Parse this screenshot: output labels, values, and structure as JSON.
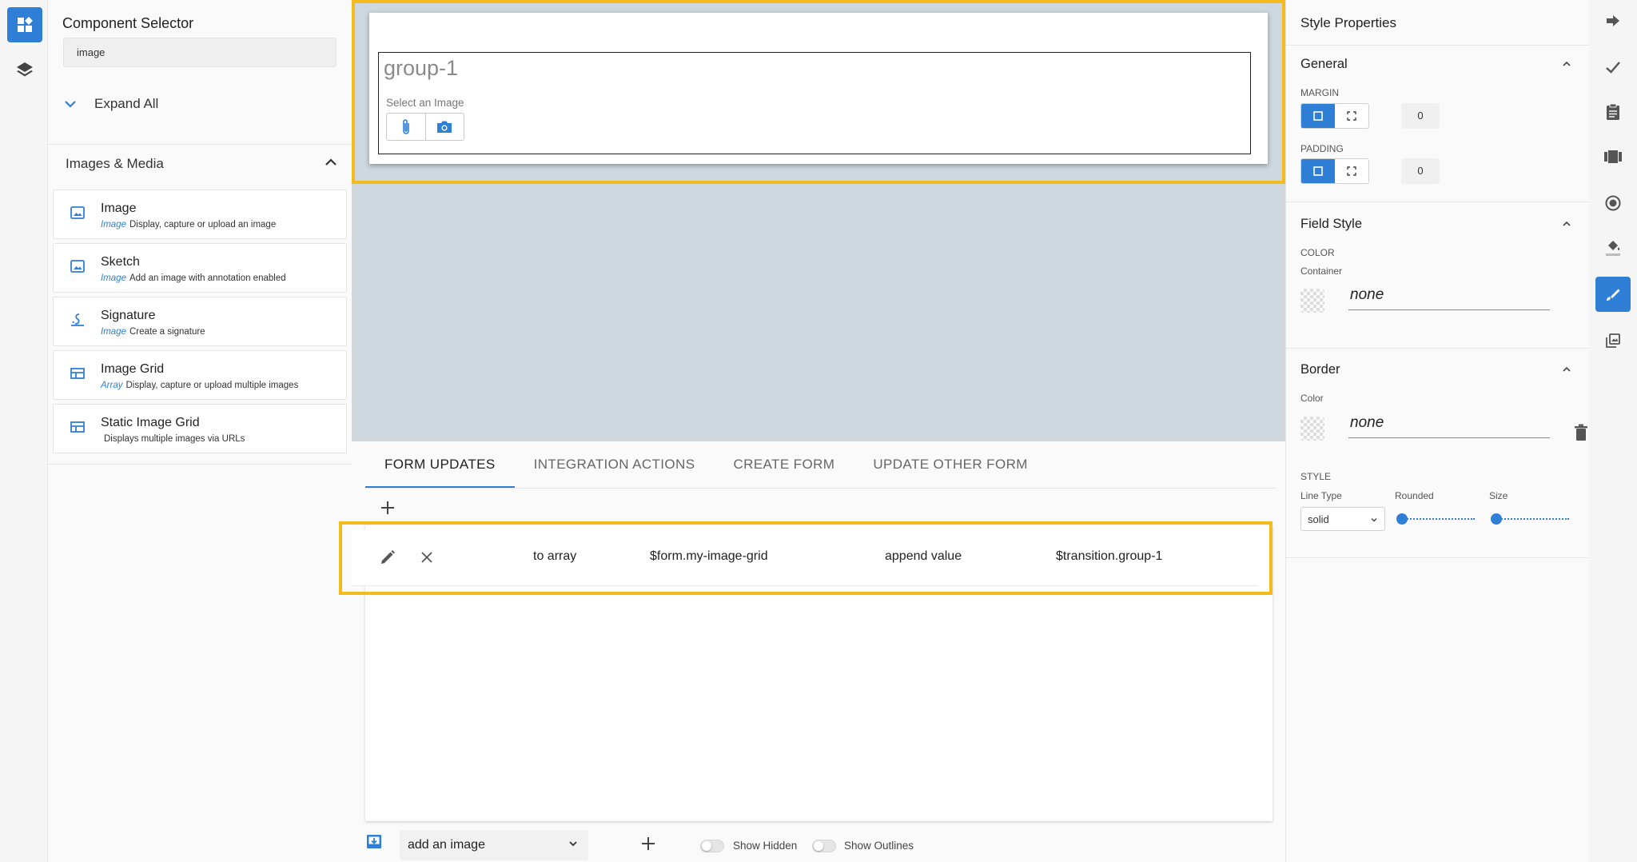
{
  "left_panel": {
    "title": "Component Selector",
    "search_value": "image",
    "expand_all_label": "Expand All",
    "section_title": "Images & Media",
    "components": [
      {
        "name": "Image",
        "type": "Image",
        "description": "Display, capture or upload an image",
        "icon": "image-icon"
      },
      {
        "name": "Sketch",
        "type": "Image",
        "description": "Add an image with annotation enabled",
        "icon": "image-icon"
      },
      {
        "name": "Signature",
        "type": "Image",
        "description": "Create a signature",
        "icon": "signature-icon"
      },
      {
        "name": "Image Grid",
        "type": "Array",
        "description": "Display, capture or upload multiple images",
        "icon": "grid-icon"
      },
      {
        "name": "Static Image Grid",
        "type": "",
        "description": "Displays multiple images via URLs",
        "icon": "grid-icon"
      }
    ]
  },
  "canvas": {
    "group_title": "group-1",
    "select_image_label": "Select an Image"
  },
  "tabs": [
    "FORM UPDATES",
    "INTEGRATION ACTIONS",
    "CREATE FORM",
    "UPDATE OTHER FORM"
  ],
  "active_tab": "FORM UPDATES",
  "update_row": {
    "target_kind": "to array",
    "target": "$form.my-image-grid",
    "operation": "append value",
    "value": "$transition.group-1"
  },
  "bottom_toolbar": {
    "add_select_value": "add an image",
    "show_hidden_label": "Show Hidden",
    "show_outlines_label": "Show Outlines"
  },
  "right_panel": {
    "title": "Style Properties",
    "general": {
      "title": "General",
      "margin_label": "MARGIN",
      "margin_value": "0",
      "padding_label": "PADDING",
      "padding_value": "0"
    },
    "field_style": {
      "title": "Field Style",
      "color_label": "COLOR",
      "container_label": "Container",
      "container_value": "none"
    },
    "border": {
      "title": "Border",
      "color_label": "Color",
      "color_value": "none",
      "style_label": "STYLE",
      "line_type_label": "Line Type",
      "rounded_label": "Rounded",
      "size_label": "Size",
      "line_type_value": "solid"
    }
  },
  "colors": {
    "accent": "#2f7fd6",
    "highlight": "#f3bc1c",
    "canvas_bg": "#cfd8df"
  }
}
